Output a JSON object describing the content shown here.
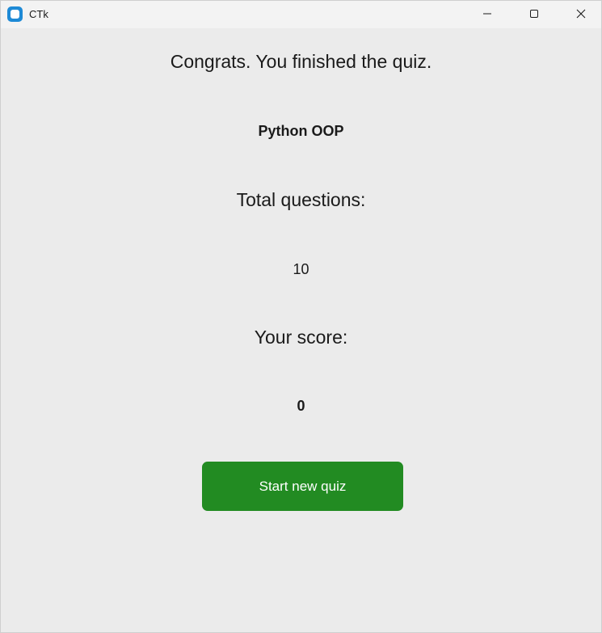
{
  "window": {
    "title": "CTk",
    "controls": {
      "minimize": "minimize-icon",
      "maximize": "maximize-icon",
      "close": "close-icon"
    }
  },
  "main": {
    "heading": "Congrats. You finished the quiz.",
    "quiz_name": "Python OOP",
    "total_label": "Total questions:",
    "total_value": "10",
    "score_label": "Your score:",
    "score_value": "0",
    "start_button_label": "Start new quiz"
  },
  "colors": {
    "background": "#ebebeb",
    "titlebar": "#f3f3f3",
    "button": "#228b22",
    "app_icon": "#1e8ad6"
  }
}
